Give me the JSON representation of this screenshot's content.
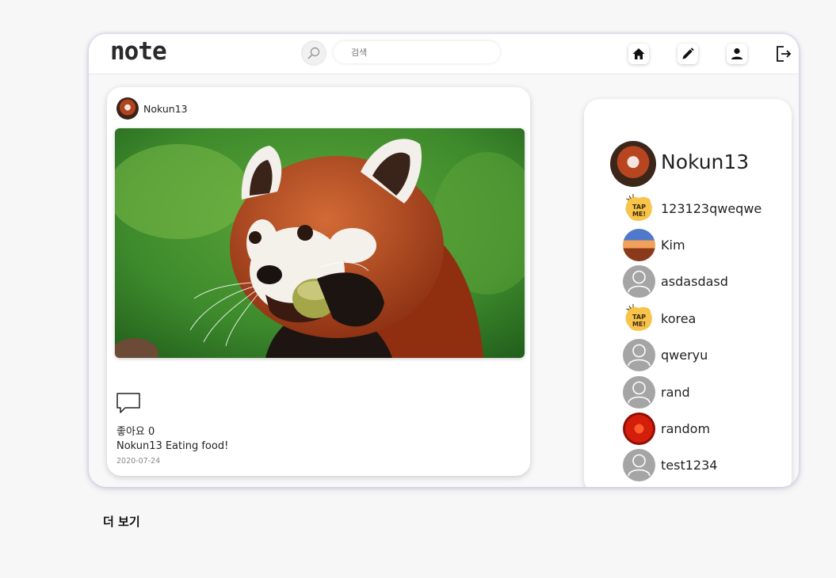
{
  "header": {
    "logo": "note",
    "search": {
      "placeholder": "검색",
      "value": ""
    },
    "icons": [
      "home-icon",
      "edit-icon",
      "profile-icon",
      "logout-icon"
    ]
  },
  "post": {
    "author": "Nokun13",
    "likes_label": "좋아요 0",
    "caption_author": "Nokun13",
    "caption_text": "Eating food!",
    "date": "2020-07-24"
  },
  "user_panel": {
    "me": "Nokun13",
    "users": [
      {
        "name": "123123qweqwe",
        "avatar": "tapme"
      },
      {
        "name": "Kim",
        "avatar": "kim"
      },
      {
        "name": "asdasdasd",
        "avatar": "default"
      },
      {
        "name": "korea",
        "avatar": "tapme"
      },
      {
        "name": "qweryu",
        "avatar": "default"
      },
      {
        "name": "rand",
        "avatar": "default"
      },
      {
        "name": "random",
        "avatar": "random"
      },
      {
        "name": "test1234",
        "avatar": "default"
      }
    ]
  },
  "footer": {
    "more_label": "더 보기"
  },
  "colors": {
    "frame_glow": "#7878c8",
    "accent": "#222222"
  }
}
